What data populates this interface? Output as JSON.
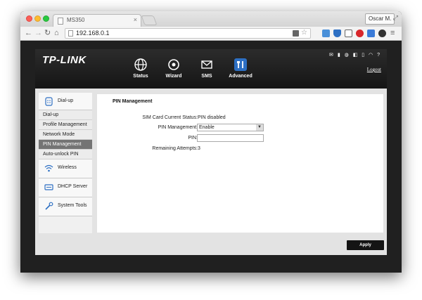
{
  "browser": {
    "tab_title": "MS350",
    "tab_close": "×",
    "profile_name": "Oscar M.",
    "url": "192.168.0.1",
    "back": "←",
    "forward": "→",
    "reload": "↻",
    "home": "⌂",
    "star": "☆",
    "menu": "≡",
    "resize": "⤢"
  },
  "router": {
    "logo": "TP-LINK",
    "logout": "Logout",
    "status_icons": "✉ ▮ ◍ ◧ ▯ ◠ ?",
    "nav": [
      {
        "label": "Status",
        "icon": "globe-icon"
      },
      {
        "label": "Wizard",
        "icon": "wizard-icon"
      },
      {
        "label": "SMS",
        "icon": "envelope-icon"
      },
      {
        "label": "Advanced",
        "icon": "tools-icon"
      }
    ],
    "sidebar": {
      "dialup": "Dial-up",
      "dialup_items": [
        "Dial-up",
        "Profile Management",
        "Network Mode",
        "PIN Management",
        "Auto-unlock PIN"
      ],
      "active_item": "PIN Management",
      "wireless": "Wireless",
      "dhcp": "DHCP Server",
      "system": "System Tools"
    },
    "content": {
      "title": "PIN Management",
      "sim_status_label": "SIM Card Current Status:",
      "sim_status_value": "PIN disabled",
      "pin_mgmt_label": "PIN Management:",
      "pin_mgmt_value": "Enable",
      "pin_label": "PIN:",
      "pin_value": "",
      "remaining_label": "Remaining Attempts:",
      "remaining_value": "3"
    },
    "apply_label": "Apply"
  },
  "colors": {
    "header_bg": "#1b1b1b",
    "active_item_bg": "#747474",
    "apply_bg": "#141414",
    "accent_blue": "#2d6fc3"
  }
}
